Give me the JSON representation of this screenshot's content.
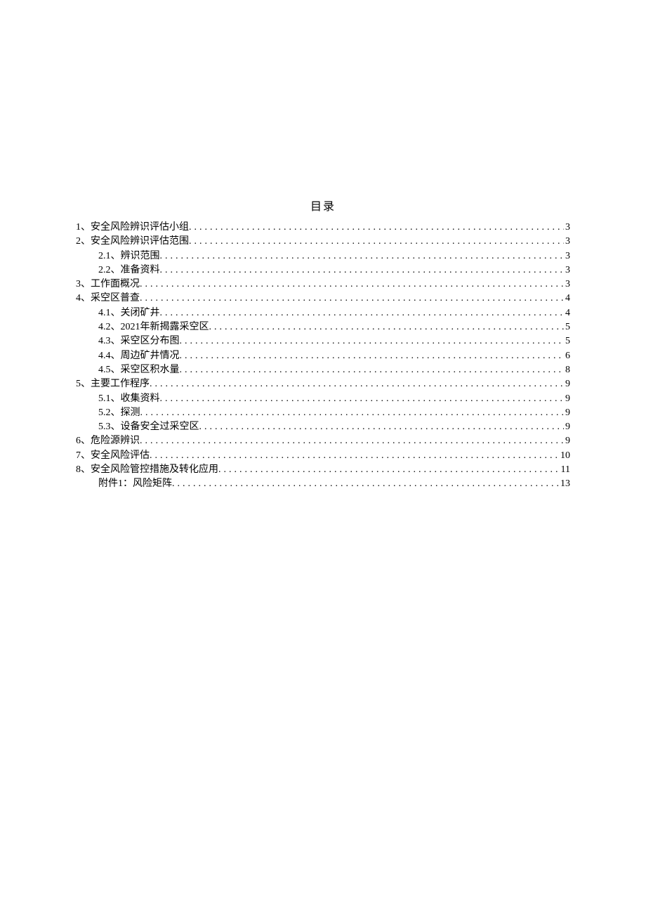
{
  "title": "目录",
  "entries": [
    {
      "level": 1,
      "num": "1、",
      "label": "安全风险辨识评估小组",
      "page": "3"
    },
    {
      "level": 1,
      "num": "2、",
      "label": "安全风险辨识评估范围",
      "page": "3"
    },
    {
      "level": 2,
      "num": "2.1、 ",
      "label": "辨识范围",
      "page": "3"
    },
    {
      "level": 2,
      "num": "2.2、 ",
      "label": "准备资料",
      "page": "3"
    },
    {
      "level": 1,
      "num": "3、",
      "label": "工作面概况",
      "page": "3"
    },
    {
      "level": 1,
      "num": "4、",
      "label": "采空区普查",
      "page": "4"
    },
    {
      "level": 2,
      "num": "4.1、 ",
      "label": "关闭矿井",
      "page": "4"
    },
    {
      "level": 2,
      "num": "4.2、 ",
      "label": "2021年新揭露采空区",
      "page": "5"
    },
    {
      "level": 2,
      "num": "4.3、 ",
      "label": "采空区分布图",
      "page": "5"
    },
    {
      "level": 2,
      "num": "4.4、 ",
      "label": "周边矿井情况",
      "page": "6"
    },
    {
      "level": 2,
      "num": "4.5、 ",
      "label": "采空区积水量",
      "page": "8"
    },
    {
      "level": 1,
      "num": "5、",
      "label": "主要工作程序",
      "page": "9"
    },
    {
      "level": 2,
      "num": "5.1、 ",
      "label": "收集资料",
      "page": "9"
    },
    {
      "level": 2,
      "num": "5.2、 ",
      "label": "探测",
      "page": "9"
    },
    {
      "level": 2,
      "num": "5.3、 ",
      "label": "设备安全过采空区",
      "page": "9"
    },
    {
      "level": 1,
      "num": "6、",
      "label": "危险源辨识",
      "page": "9"
    },
    {
      "level": 1,
      "num": "7、",
      "label": "安全风险评估",
      "page": "10"
    },
    {
      "level": 1,
      "num": "8、",
      "label": "安全风险管控措施及转化应用",
      "page": "11"
    },
    {
      "level": 2,
      "num": "附件1： ",
      "label": "风险矩阵",
      "page": "13"
    }
  ]
}
